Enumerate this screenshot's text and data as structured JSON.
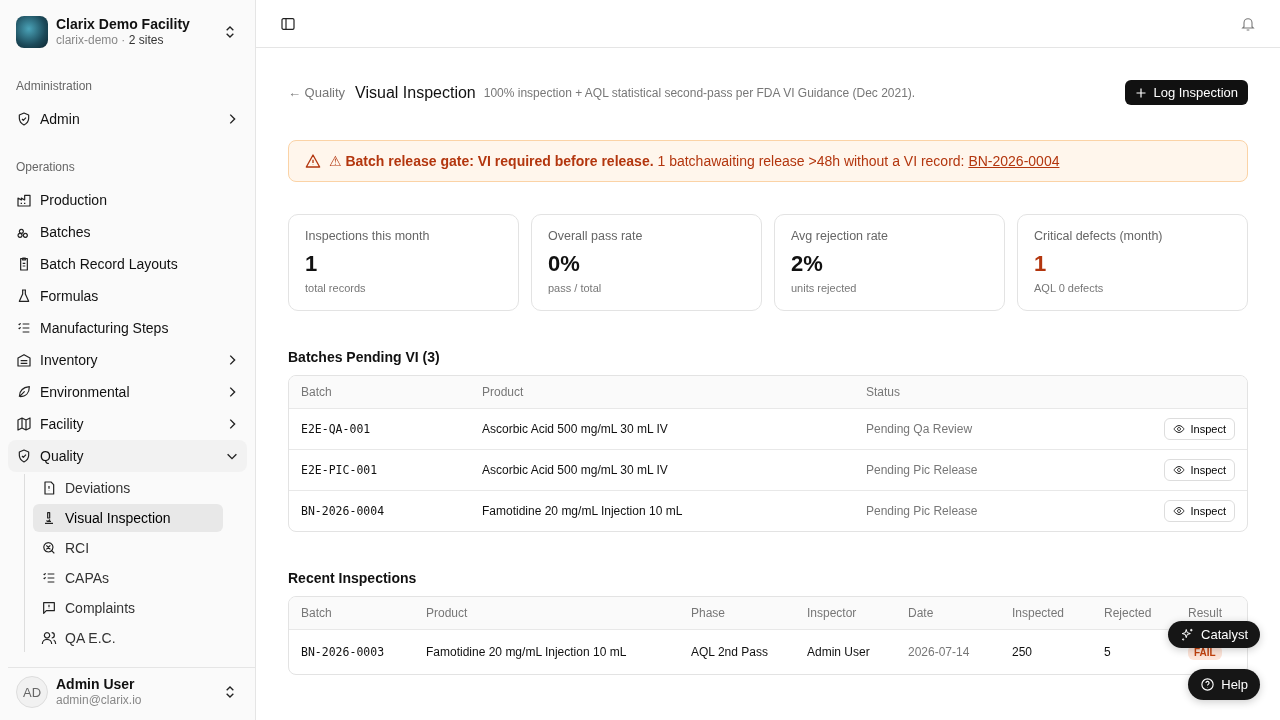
{
  "org": {
    "name": "Clarix Demo Facility",
    "slug": "clarix-demo",
    "separator": "·",
    "sites": "2 sites"
  },
  "sidebar": {
    "sections": [
      {
        "title": "Administration",
        "items": [
          {
            "label": "Admin",
            "expandable": true,
            "expanded": false,
            "selected": false
          }
        ]
      },
      {
        "title": "Operations",
        "items": [
          {
            "label": "Production",
            "expandable": false,
            "selected": false
          },
          {
            "label": "Batches",
            "expandable": false,
            "selected": false
          },
          {
            "label": "Batch Record Layouts",
            "expandable": false,
            "selected": false
          },
          {
            "label": "Formulas",
            "expandable": false,
            "selected": false
          },
          {
            "label": "Manufacturing Steps",
            "expandable": false,
            "selected": false
          },
          {
            "label": "Inventory",
            "expandable": true,
            "expanded": false,
            "selected": false
          },
          {
            "label": "Environmental",
            "expandable": true,
            "expanded": false,
            "selected": false
          },
          {
            "label": "Facility",
            "expandable": true,
            "expanded": false,
            "selected": false
          },
          {
            "label": "Quality",
            "expandable": true,
            "expanded": true,
            "selected": false,
            "children": [
              {
                "label": "Deviations",
                "selected": false
              },
              {
                "label": "Visual Inspection",
                "selected": true
              },
              {
                "label": "RCI",
                "selected": false
              },
              {
                "label": "CAPAs",
                "selected": false
              },
              {
                "label": "Complaints",
                "selected": false
              },
              {
                "label": "QA E.C.",
                "selected": false
              }
            ]
          }
        ]
      }
    ]
  },
  "user": {
    "initials": "AD",
    "name": "Admin User",
    "email": "admin@clarix.io"
  },
  "page": {
    "back": "← Quality",
    "title": "Visual Inspection",
    "subtitle": "100% inspection + AQL statistical second-pass per FDA VI Guidance (Dec 2021).",
    "action": "Log Inspection"
  },
  "alert": {
    "text": "**⚠ Batch release gate: VI required before release.** 1 batchawaiting release >48h without a VI record: ",
    "link": "BN-2026-0004"
  },
  "stats": [
    {
      "label": "Inspections this month",
      "value": "1",
      "note": "total records",
      "critical": false
    },
    {
      "label": "Overall pass rate",
      "value": "0%",
      "note": "pass / total",
      "critical": false
    },
    {
      "label": "Avg rejection rate",
      "value": "2%",
      "note": "units rejected",
      "critical": false
    },
    {
      "label": "Critical defects (month)",
      "value": "1",
      "note": "AQL 0 defects",
      "critical": true
    }
  ],
  "pending": {
    "title": "Batches Pending VI (3)",
    "columns": [
      "Batch",
      "Product",
      "Status"
    ],
    "rows": [
      {
        "batch": "E2E-QA-001",
        "product": "Ascorbic Acid 500 mg/mL 30 mL IV",
        "status": "Pending Qa Review",
        "action": "Inspect"
      },
      {
        "batch": "E2E-PIC-001",
        "product": "Ascorbic Acid 500 mg/mL 30 mL IV",
        "status": "Pending Pic Release",
        "action": "Inspect"
      },
      {
        "batch": "BN-2026-0004",
        "product": "Famotidine 20 mg/mL Injection 10 mL",
        "status": "Pending Pic Release",
        "action": "Inspect"
      }
    ]
  },
  "recent": {
    "title": "Recent Inspections",
    "columns": [
      "Batch",
      "Product",
      "Phase",
      "Inspector",
      "Date",
      "Inspected",
      "Rejected",
      "Result"
    ],
    "rows": [
      {
        "batch": "BN-2026-0003",
        "product": "Famotidine 20 mg/mL Injection 10 mL",
        "phase": "AQL 2nd Pass",
        "inspector": "Admin User",
        "date": "2026-07-14",
        "inspected": "250",
        "rejected": "5",
        "result": "FAIL",
        "passed": false
      }
    ]
  },
  "floating": {
    "catalyst": "Catalyst",
    "help": "Help"
  }
}
